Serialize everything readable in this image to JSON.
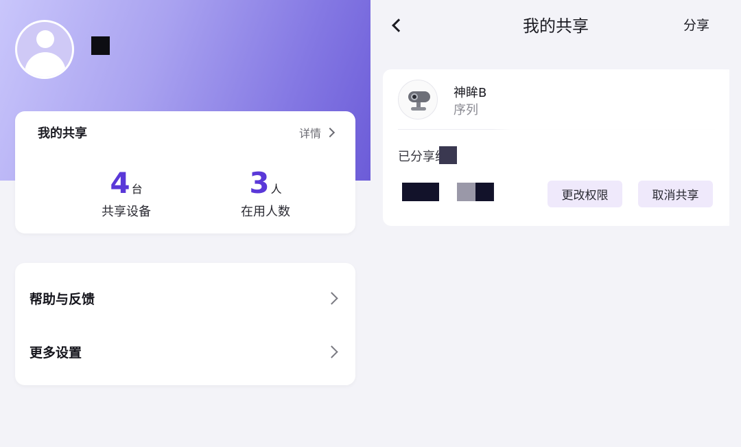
{
  "left_panel": {
    "profile": {
      "avatar_icon": "user-avatar-icon"
    },
    "my_share_card": {
      "title": "我的共享",
      "detail_label": "详情",
      "stats": [
        {
          "value": "4",
          "unit": "台",
          "label": "共享设备"
        },
        {
          "value": "3",
          "unit": "人",
          "label": "在用人数"
        }
      ]
    },
    "menu": {
      "items": [
        {
          "label": "帮助与反馈"
        },
        {
          "label": "更多设置"
        }
      ]
    },
    "colors": {
      "accent": "#5a38d8",
      "hero_gradient_end": "#6c5cd8"
    }
  },
  "right_panel": {
    "header": {
      "title": "我的共享",
      "share_label": "分享"
    },
    "device": {
      "name": "神眸B",
      "serial_label": "序列",
      "shared_label": "已分享给"
    },
    "actions": {
      "change_permission": "更改权限",
      "cancel_share": "取消共享"
    }
  }
}
